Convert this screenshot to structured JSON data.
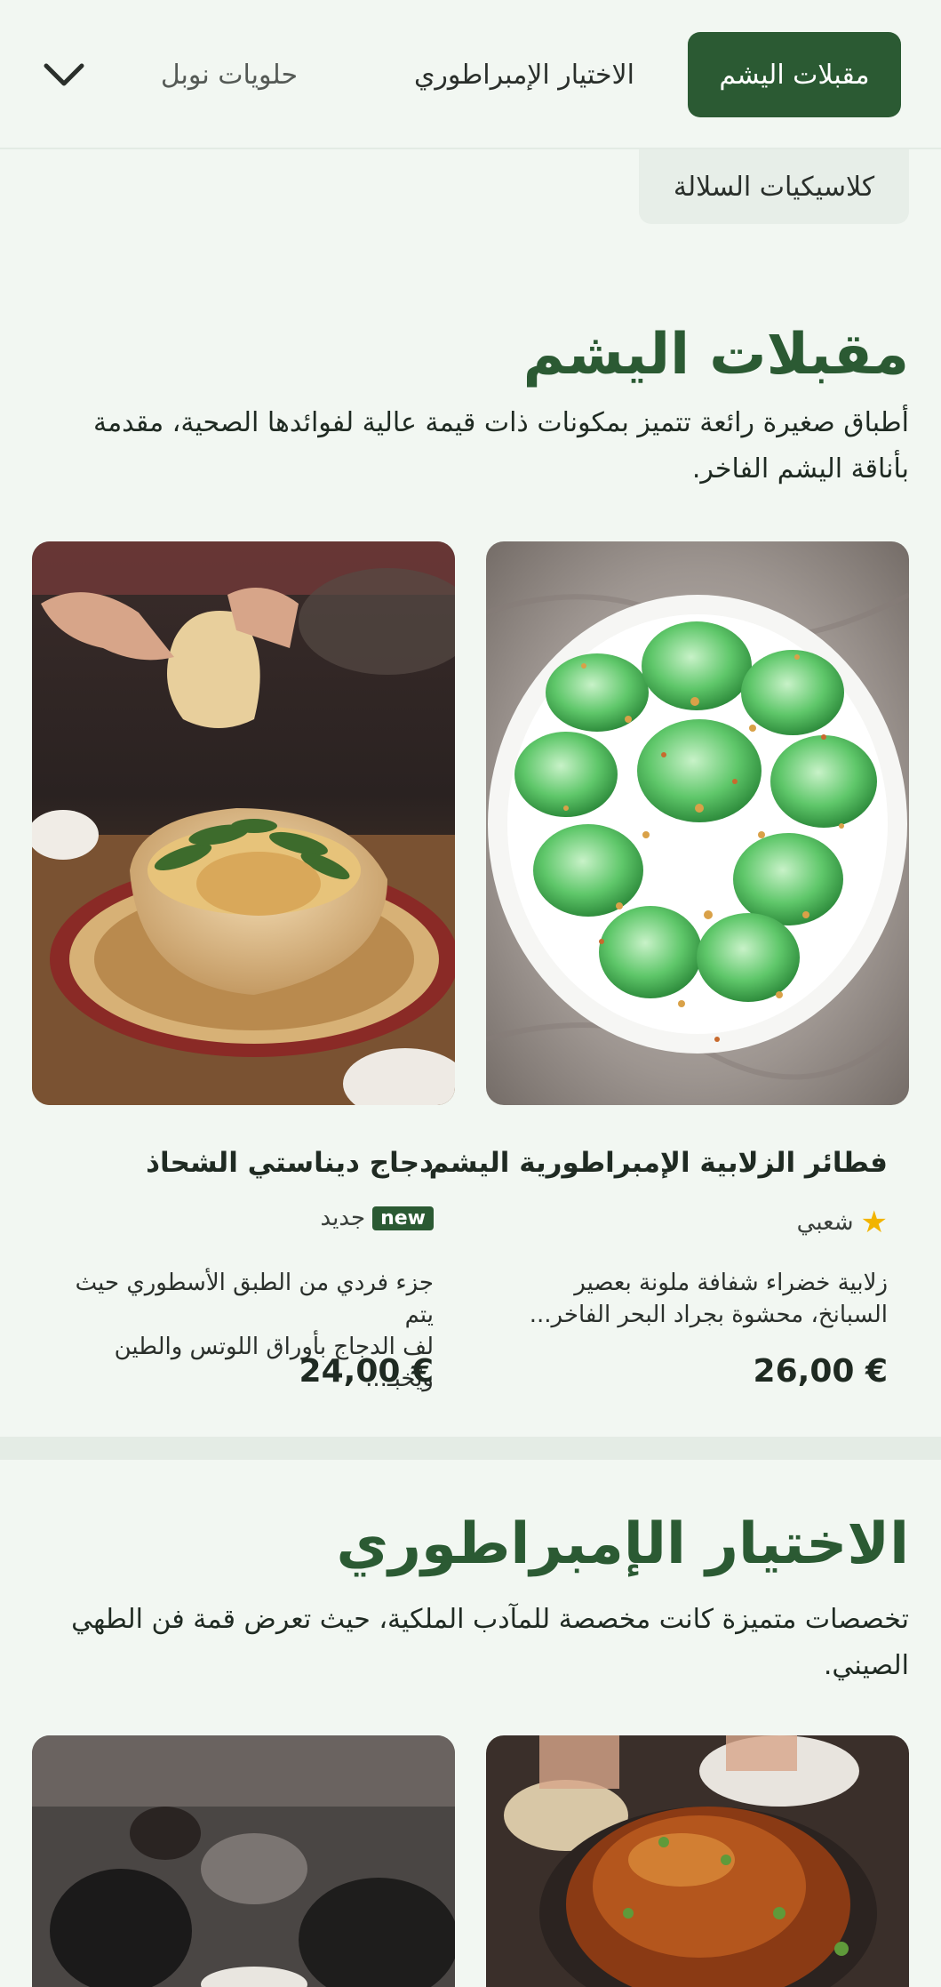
{
  "nav": {
    "tabs": [
      {
        "label": "مقبلات اليشم",
        "active": true
      },
      {
        "label": "الاختيار الإمبراطوري",
        "active": false
      },
      {
        "label": "حلويات نوبل",
        "active": false
      }
    ],
    "row2_label": "كلاسيكيات السلالة",
    "expand_icon": "chevron-down-icon",
    "accent_color": "#2b5a33"
  },
  "sections": [
    {
      "title": "مقبلات اليشم",
      "description": "أطباق صغيرة رائعة تتميز بمكونات ذات قيمة عالية لفوائدها الصحية، مقدمة بأناقة اليشم الفاخر.",
      "items": [
        {
          "title": "فطائر الزلابية الإمبراطورية اليشم",
          "tag_icon": "star-icon",
          "tag": "شعبي",
          "description_line1": "زلابية خضراء شفافة ملونة بعصير",
          "description_line2": "السبانخ، محشوة بجراد البحر الفاخر...",
          "price": "26,00 €"
        },
        {
          "title": "دجاج ديناستي الشحاذ",
          "badge": "new",
          "tag": "جديد",
          "description_line1": "جزء فردي من الطبق الأسطوري حيث يتم",
          "description_line2": "لف الدجاج بأوراق اللوتس والطين ويُخبـ...",
          "price": "24,00 €"
        }
      ]
    },
    {
      "title": "الاختيار الإمبراطوري",
      "description": "تخصصات متميزة كانت مخصصة للمآدب الملكية، حيث تعرض قمة فن الطهي الصيني."
    }
  ]
}
